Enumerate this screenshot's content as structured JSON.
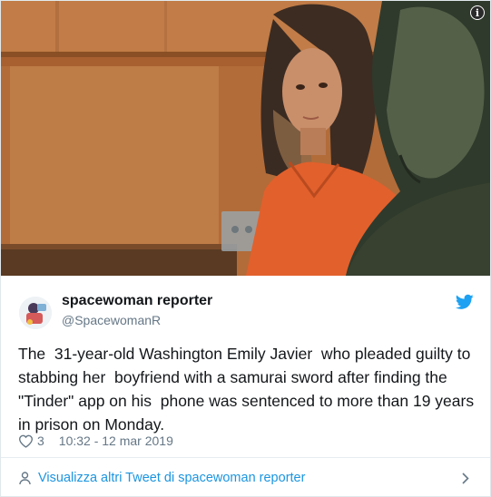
{
  "media": {
    "alt_icon": "info-icon",
    "info_glyph": "i"
  },
  "tweet": {
    "display_name": "spacewoman reporter",
    "handle": "@SpacewomanR",
    "text": "The  31-year-old Washington Emily Javier  who pleaded guilty to stabbing her  boyfriend with a samurai sword after finding the \"Tinder\" app on his  phone was sentenced to more than 19 years in prison on Monday.",
    "likes": "3",
    "timestamp": "10:32 - 12 mar 2019",
    "icons": {
      "brand": "twitter-bird-icon",
      "like": "heart-icon",
      "avatar": "avatar"
    }
  },
  "footer": {
    "link_label": "Visualizza altri Tweet di spacewoman reporter",
    "icons": {
      "left": "person-icon",
      "right": "chevron-right-icon"
    }
  },
  "colors": {
    "link_blue": "#1b95e0",
    "twitter_blue": "#1da1f2",
    "secondary_text": "#657786",
    "primary_text": "#14171a",
    "jumpsuit_orange": "#e2602c"
  }
}
